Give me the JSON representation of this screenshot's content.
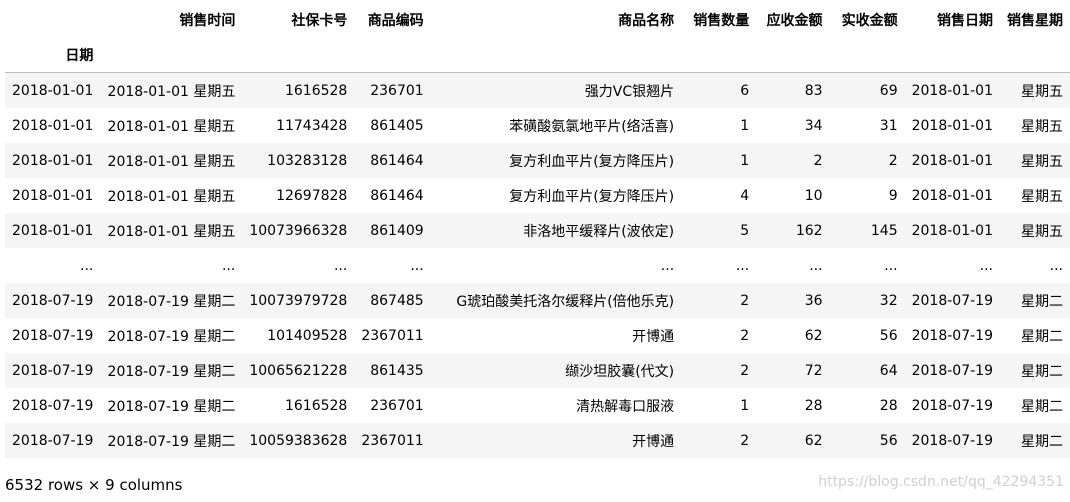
{
  "columns": [
    "销售时间",
    "社保卡号",
    "商品编码",
    "商品名称",
    "销售数量",
    "应收金额",
    "实收金额",
    "销售日期",
    "销售星期"
  ],
  "index_name": "日期",
  "rows": [
    {
      "index": "2018-01-01",
      "cells": [
        "2018-01-01 星期五",
        "1616528",
        "236701",
        "强力VC银翘片",
        "6",
        "83",
        "69",
        "2018-01-01",
        "星期五"
      ]
    },
    {
      "index": "2018-01-01",
      "cells": [
        "2018-01-01 星期五",
        "11743428",
        "861405",
        "苯磺酸氨氯地平片(络活喜)",
        "1",
        "34",
        "31",
        "2018-01-01",
        "星期五"
      ]
    },
    {
      "index": "2018-01-01",
      "cells": [
        "2018-01-01 星期五",
        "103283128",
        "861464",
        "复方利血平片(复方降压片)",
        "1",
        "2",
        "2",
        "2018-01-01",
        "星期五"
      ]
    },
    {
      "index": "2018-01-01",
      "cells": [
        "2018-01-01 星期五",
        "12697828",
        "861464",
        "复方利血平片(复方降压片)",
        "4",
        "10",
        "9",
        "2018-01-01",
        "星期五"
      ]
    },
    {
      "index": "2018-01-01",
      "cells": [
        "2018-01-01 星期五",
        "10073966328",
        "861409",
        "非洛地平缓释片(波依定)",
        "5",
        "162",
        "145",
        "2018-01-01",
        "星期五"
      ]
    },
    {
      "index": "...",
      "cells": [
        "...",
        "...",
        "...",
        "...",
        "...",
        "...",
        "...",
        "...",
        "..."
      ]
    },
    {
      "index": "2018-07-19",
      "cells": [
        "2018-07-19 星期二",
        "10073979728",
        "867485",
        "G琥珀酸美托洛尔缓释片(倍他乐克)",
        "2",
        "36",
        "32",
        "2018-07-19",
        "星期二"
      ]
    },
    {
      "index": "2018-07-19",
      "cells": [
        "2018-07-19 星期二",
        "101409528",
        "2367011",
        "开博通",
        "2",
        "62",
        "56",
        "2018-07-19",
        "星期二"
      ]
    },
    {
      "index": "2018-07-19",
      "cells": [
        "2018-07-19 星期二",
        "10065621228",
        "861435",
        "缬沙坦胶囊(代文)",
        "2",
        "72",
        "64",
        "2018-07-19",
        "星期二"
      ]
    },
    {
      "index": "2018-07-19",
      "cells": [
        "2018-07-19 星期二",
        "1616528",
        "236701",
        "清热解毒口服液",
        "1",
        "28",
        "28",
        "2018-07-19",
        "星期二"
      ]
    },
    {
      "index": "2018-07-19",
      "cells": [
        "2018-07-19 星期二",
        "10059383628",
        "2367011",
        "开博通",
        "2",
        "62",
        "56",
        "2018-07-19",
        "星期二"
      ]
    }
  ],
  "footer": "6532 rows × 9 columns",
  "watermark": "https://blog.csdn.net/qq_42294351"
}
